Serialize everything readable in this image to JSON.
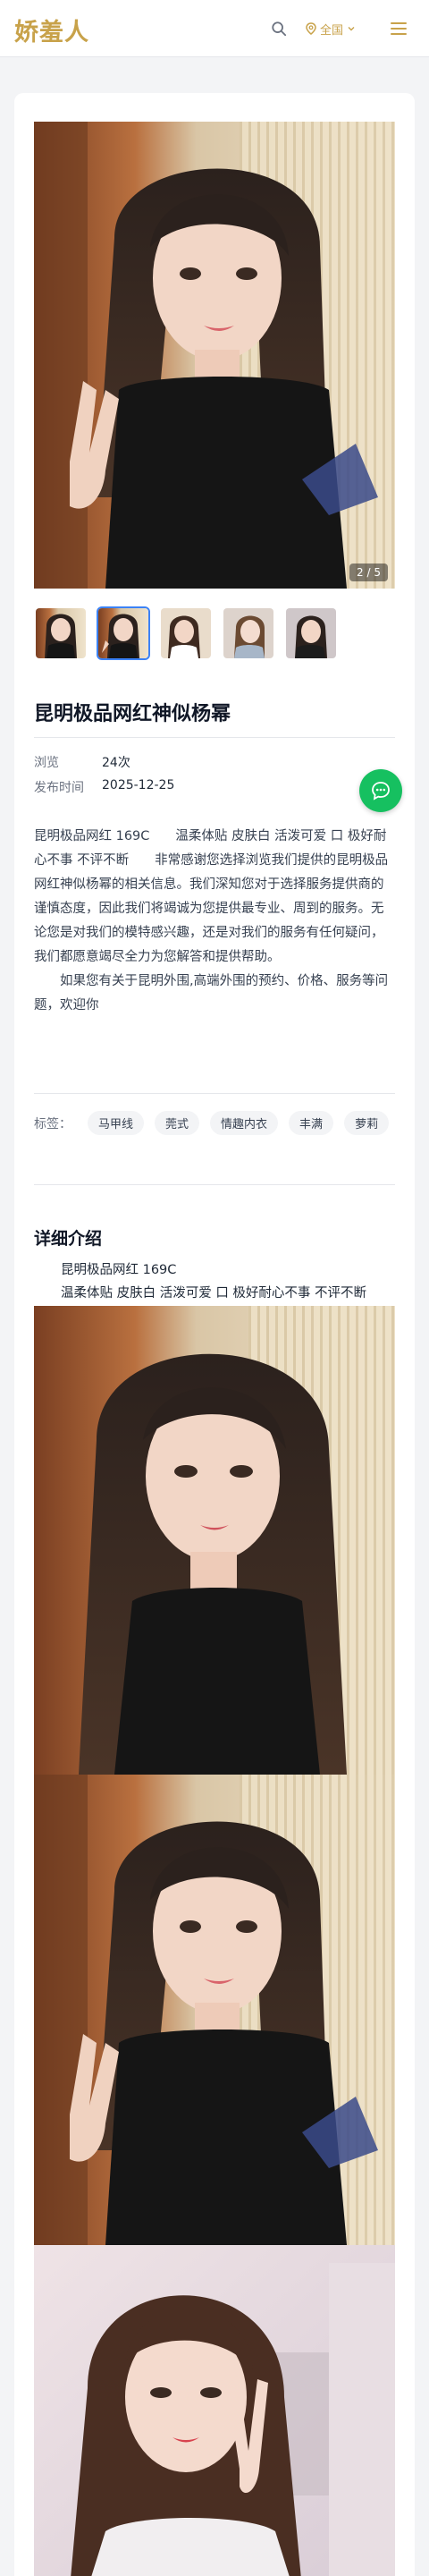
{
  "header": {
    "logo": "娇羞人",
    "region": "全国",
    "search_icon": "search-icon",
    "menu_icon": "menu-icon"
  },
  "gallery": {
    "counter": "2 / 5",
    "thumb_count": 5,
    "active_thumb": 2
  },
  "post": {
    "title": "昆明极品网红神似杨幂",
    "views_label": "浏览",
    "views_value": "24次",
    "date_label": "发布时间",
    "date_value": "2025-12-25",
    "description_p1": "昆明极品网红 169C　　温柔体贴 皮肤白 活泼可爱 口 极好耐心不事 不评不断　　非常感谢您选择浏览我们提供的昆明极品网红神似杨幂的相关信息。我们深知您对于选择服务提供商的谨慎态度，因此我们将竭诚为您提供最专业、周到的服务。无论您是对我们的模特感兴趣，还是对我们的服务有任何疑问，我们都愿意竭尽全力为您解答和提供帮助。",
    "description_p2": "　　如果您有关于昆明外围,高端外围的预约、价格、服务等问题，欢迎你"
  },
  "tags": {
    "label": "标签：",
    "items": [
      "马甲线",
      "莞式",
      "情趣内衣",
      "丰满",
      "萝莉"
    ]
  },
  "details": {
    "section_title": "详细介绍",
    "line1": "昆明极品网红 169C",
    "line2": "温柔体贴 皮肤白 活泼可爱 口 极好耐心不事 不评不断"
  },
  "colors": {
    "accent": "#c8a24a",
    "active_border": "#3b82f6",
    "chat_green": "#16c060"
  }
}
